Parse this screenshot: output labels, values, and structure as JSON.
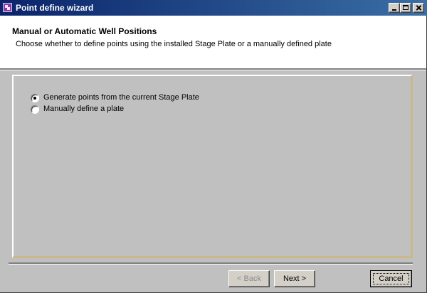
{
  "window": {
    "title": "Point define wizard",
    "icon": "app-icon",
    "controls": {
      "minimize": "minimize-icon",
      "maximize": "maximize-icon",
      "close": "close-icon"
    }
  },
  "header": {
    "title": "Manual or Automatic Well Positions",
    "subtitle": "Choose whether to define points using the installed Stage Plate or a manually defined plate"
  },
  "options": [
    {
      "label": "Generate points from the current Stage Plate",
      "checked": true
    },
    {
      "label": "Manually define a plate",
      "checked": false
    }
  ],
  "buttons": {
    "back": "< Back",
    "next": "Next >",
    "cancel": "Cancel"
  },
  "colors": {
    "title_bar_start": "#0a246a",
    "title_bar_end": "#3a6ea5",
    "panel_bg": "#c0c0c0",
    "panel_accent_border": "#c8b88a"
  }
}
